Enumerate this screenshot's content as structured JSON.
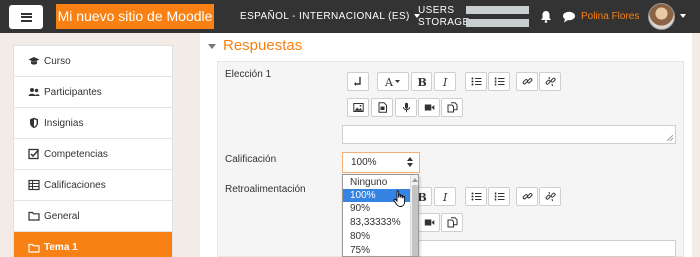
{
  "navbar": {
    "site_name": "Mi nuevo sitio de Moodle",
    "language": "ESPAÑOL - INTERNACIONAL (ES)",
    "usage": [
      {
        "label": "USERS",
        "fill": 1.0
      },
      {
        "label": "STORAGE",
        "fill": 1.0
      }
    ],
    "user_name": "Polina Flores",
    "icons": [
      "menu-icon",
      "bell-icon",
      "chat-icon",
      "avatar"
    ]
  },
  "drawer": {
    "items": [
      {
        "label": "Curso",
        "icon": "graduation-cap-icon"
      },
      {
        "label": "Participantes",
        "icon": "users-icon"
      },
      {
        "label": "Insignias",
        "icon": "shield-icon"
      },
      {
        "label": "Competencias",
        "icon": "checkbox-icon"
      },
      {
        "label": "Calificaciones",
        "icon": "table-icon"
      },
      {
        "label": "General",
        "icon": "folder-icon"
      },
      {
        "label": "Tema 1",
        "icon": "folder-icon",
        "active": true
      }
    ]
  },
  "section": {
    "title": "Respuestas"
  },
  "form": {
    "choice_label": "Elección 1",
    "grade_label": "Calificación",
    "feedback_label": "Retroalimentación",
    "grade_value": "100%",
    "grade_options": [
      "Ninguno",
      "100%",
      "90%",
      "83,33333%",
      "80%",
      "75%"
    ],
    "grade_selected": "100%"
  },
  "colors": {
    "brand": "#f98012",
    "navbar": "#333333",
    "selection": "#3584e4"
  }
}
